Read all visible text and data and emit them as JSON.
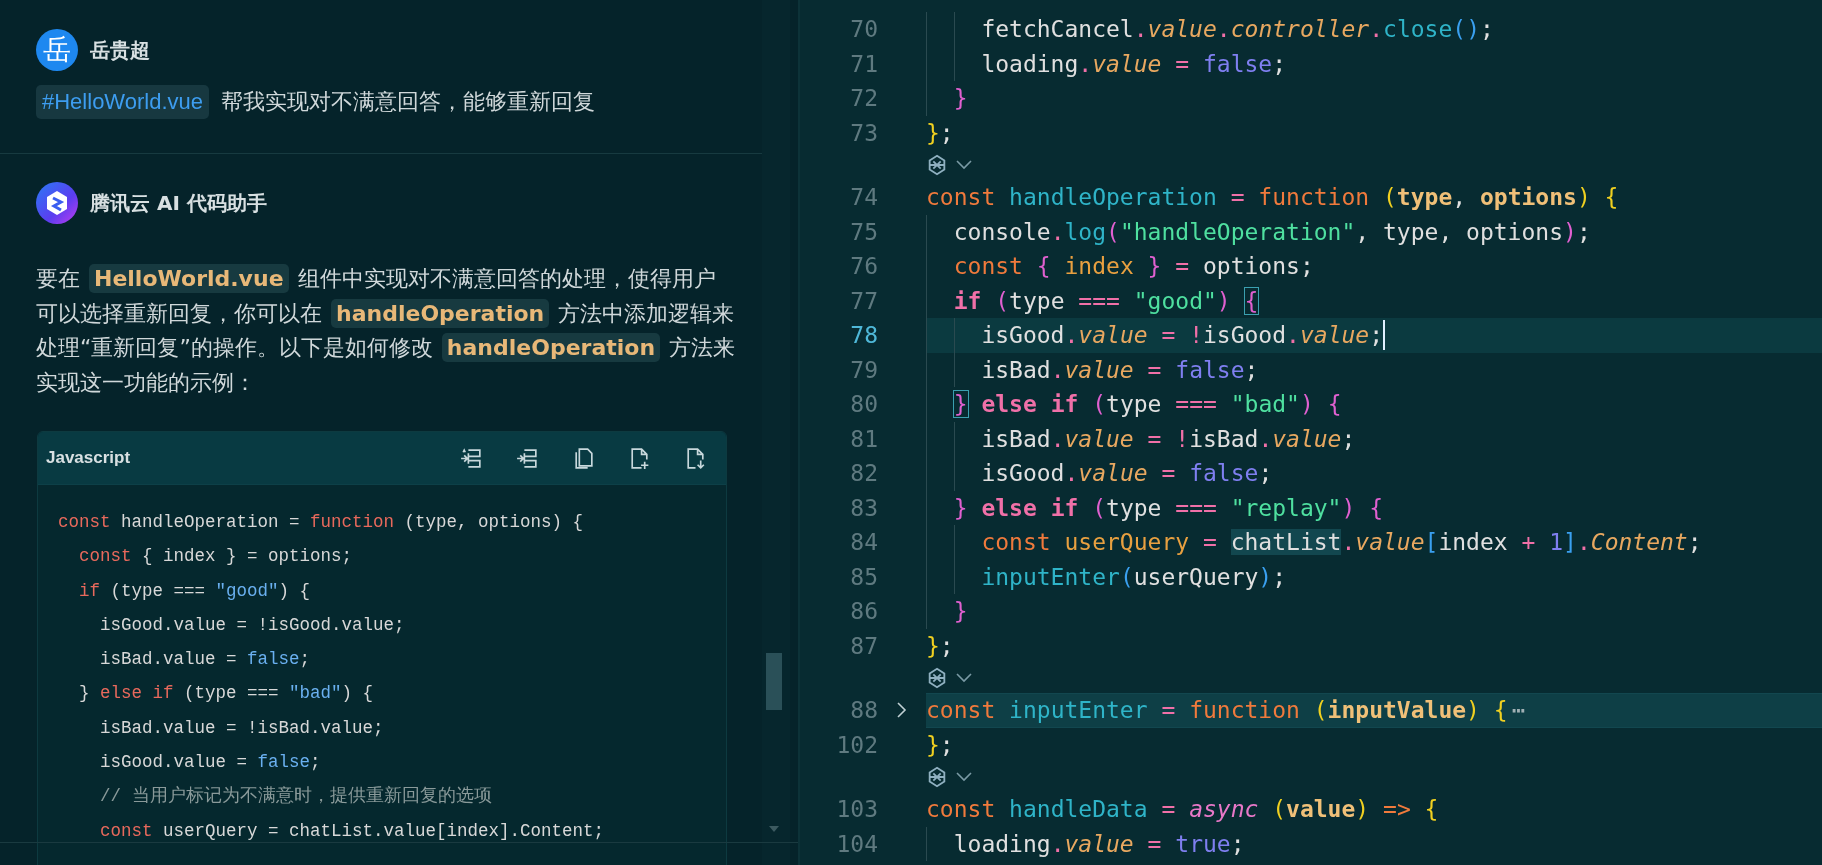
{
  "chat": {
    "messages": [
      {
        "kind": "user",
        "avatar": "岳",
        "author": "岳贵超",
        "tag": "#HelloWorld.vue",
        "text": "帮我实现对不满意回答，能够重新回复"
      },
      {
        "kind": "assistant",
        "author": "腾讯云 AI 代码助手",
        "segments": [
          {
            "kind": "text",
            "text": "要在 "
          },
          {
            "kind": "code",
            "text": "HelloWorld.vue"
          },
          {
            "kind": "text",
            "text": " 组件中实现对不满意回答的处理，使得用户可以选择重新回复，你可以在 "
          },
          {
            "kind": "code",
            "text": "handleOperation"
          },
          {
            "kind": "text",
            "text": " 方法中添加逻辑来处理“重新回复”的操作。以下是如何修改 "
          },
          {
            "kind": "code",
            "text": "handleOperation"
          },
          {
            "kind": "text",
            "text": " 方法来实现这一功能的示例："
          }
        ],
        "code_block": {
          "language": "Javascript",
          "lines": [
            [
              {
                "kind": "kw",
                "text": "const "
              },
              {
                "kind": "id",
                "text": "handleOperation = "
              },
              {
                "kind": "kw",
                "text": "function "
              },
              {
                "kind": "id",
                "text": "(type, options) {"
              }
            ],
            [
              {
                "kind": "kw",
                "text": "  const "
              },
              {
                "kind": "id",
                "text": "{ index } = options;"
              }
            ],
            [
              {
                "kind": "kw",
                "text": "  if "
              },
              {
                "kind": "id",
                "text": "(type === "
              },
              {
                "kind": "str",
                "text": "\"good\""
              },
              {
                "kind": "id",
                "text": ") {"
              }
            ],
            [
              {
                "kind": "id",
                "text": "    isGood.value = !isGood.value;"
              }
            ],
            [
              {
                "kind": "id",
                "text": "    isBad.value = "
              },
              {
                "kind": "bool",
                "text": "false"
              },
              {
                "kind": "id",
                "text": ";"
              }
            ],
            [
              {
                "kind": "id",
                "text": "  } "
              },
              {
                "kind": "kw",
                "text": "else if "
              },
              {
                "kind": "id",
                "text": "(type === "
              },
              {
                "kind": "str",
                "text": "\"bad\""
              },
              {
                "kind": "id",
                "text": ") {"
              }
            ],
            [
              {
                "kind": "id",
                "text": "    isBad.value = !isBad.value;"
              }
            ],
            [
              {
                "kind": "id",
                "text": "    isGood.value = "
              },
              {
                "kind": "bool",
                "text": "false"
              },
              {
                "kind": "id",
                "text": ";"
              }
            ],
            [
              {
                "kind": "cm",
                "text": "    // 当用户标记为不满意时，提供重新回复的选项"
              }
            ],
            [
              {
                "kind": "kw",
                "text": "    const "
              },
              {
                "kind": "id",
                "text": "userQuery = chatList.value[index].Content;"
              }
            ]
          ]
        }
      }
    ]
  },
  "editor": {
    "lines": [
      {
        "kind": "code",
        "number": "70",
        "current": false,
        "folded": false,
        "tokens": [
          {
            "kind": "id",
            "text": "    fetchCancel"
          },
          {
            "kind": "op",
            "text": "."
          },
          {
            "kind": "prop",
            "text": "value"
          },
          {
            "kind": "op",
            "text": "."
          },
          {
            "kind": "prop",
            "text": "controller"
          },
          {
            "kind": "op",
            "text": "."
          },
          {
            "kind": "fn",
            "text": "close"
          },
          {
            "kind": "bl",
            "text": "()"
          },
          {
            "kind": "id",
            "text": ";"
          }
        ]
      },
      {
        "kind": "code",
        "number": "71",
        "current": false,
        "folded": false,
        "tokens": [
          {
            "kind": "id",
            "text": "    loading"
          },
          {
            "kind": "op",
            "text": "."
          },
          {
            "kind": "prop",
            "text": "value"
          },
          {
            "kind": "op",
            "text": " = "
          },
          {
            "kind": "bool",
            "text": "false"
          },
          {
            "kind": "id",
            "text": ";"
          }
        ]
      },
      {
        "kind": "code",
        "number": "72",
        "current": false,
        "folded": false,
        "tokens": [
          {
            "kind": "pk",
            "text": "  }"
          }
        ]
      },
      {
        "kind": "code",
        "number": "73",
        "current": false,
        "folded": false,
        "tokens": [
          {
            "kind": "y",
            "text": "}"
          },
          {
            "kind": "id",
            "text": ";"
          }
        ]
      },
      {
        "kind": "lens"
      },
      {
        "kind": "code",
        "number": "74",
        "current": false,
        "folded": false,
        "tokens": [
          {
            "kind": "kw",
            "text": "const "
          },
          {
            "kind": "fn",
            "text": "handleOperation"
          },
          {
            "kind": "op",
            "text": " = "
          },
          {
            "kind": "kw",
            "text": "function "
          },
          {
            "kind": "y",
            "text": "("
          },
          {
            "kind": "par",
            "text": "type"
          },
          {
            "kind": "id",
            "text": ", "
          },
          {
            "kind": "par",
            "text": "options"
          },
          {
            "kind": "y",
            "text": ") {"
          }
        ]
      },
      {
        "kind": "code",
        "number": "75",
        "current": false,
        "folded": false,
        "tokens": [
          {
            "kind": "id",
            "text": "  console"
          },
          {
            "kind": "op",
            "text": "."
          },
          {
            "kind": "fn",
            "text": "log"
          },
          {
            "kind": "pk",
            "text": "("
          },
          {
            "kind": "str",
            "text": "\"handleOperation\""
          },
          {
            "kind": "id",
            "text": ", type, options"
          },
          {
            "kind": "pk",
            "text": ")"
          },
          {
            "kind": "id",
            "text": ";"
          }
        ]
      },
      {
        "kind": "code",
        "number": "76",
        "current": false,
        "folded": false,
        "tokens": [
          {
            "kind": "kw",
            "text": "  const "
          },
          {
            "kind": "pk",
            "text": "{"
          },
          {
            "kind": "var",
            "text": " index "
          },
          {
            "kind": "pk",
            "text": "}"
          },
          {
            "kind": "op",
            "text": " = "
          },
          {
            "kind": "id",
            "text": "options;"
          }
        ]
      },
      {
        "kind": "code",
        "number": "77",
        "current": false,
        "folded": false,
        "tokens": [
          {
            "kind": "ctl",
            "text": "  if "
          },
          {
            "kind": "pk",
            "text": "("
          },
          {
            "kind": "id",
            "text": "type "
          },
          {
            "kind": "op",
            "text": "=== "
          },
          {
            "kind": "str",
            "text": "\"good\""
          },
          {
            "kind": "pk",
            "text": ") "
          },
          {
            "kind": "pm",
            "text": "{"
          }
        ]
      },
      {
        "kind": "code",
        "number": "78",
        "current": true,
        "folded": false,
        "tokens": [
          {
            "kind": "id",
            "text": "    isGood"
          },
          {
            "kind": "op",
            "text": "."
          },
          {
            "kind": "prop",
            "text": "value"
          },
          {
            "kind": "op",
            "text": " = !"
          },
          {
            "kind": "id",
            "text": "isGood"
          },
          {
            "kind": "op",
            "text": "."
          },
          {
            "kind": "prop",
            "text": "value"
          },
          {
            "kind": "id",
            "text": ";"
          }
        ]
      },
      {
        "kind": "code",
        "number": "79",
        "current": false,
        "folded": false,
        "tokens": [
          {
            "kind": "id",
            "text": "    isBad"
          },
          {
            "kind": "op",
            "text": "."
          },
          {
            "kind": "prop",
            "text": "value"
          },
          {
            "kind": "op",
            "text": " = "
          },
          {
            "kind": "bool",
            "text": "false"
          },
          {
            "kind": "id",
            "text": ";"
          }
        ]
      },
      {
        "kind": "code",
        "number": "80",
        "current": false,
        "folded": false,
        "tokens": [
          {
            "kind": "pm",
            "text": "  }"
          },
          {
            "kind": "ctl",
            "text": " else if "
          },
          {
            "kind": "pk",
            "text": "("
          },
          {
            "kind": "id",
            "text": "type "
          },
          {
            "kind": "op",
            "text": "=== "
          },
          {
            "kind": "str",
            "text": "\"bad\""
          },
          {
            "kind": "pk",
            "text": ") {"
          }
        ]
      },
      {
        "kind": "code",
        "number": "81",
        "current": false,
        "folded": false,
        "tokens": [
          {
            "kind": "id",
            "text": "    isBad"
          },
          {
            "kind": "op",
            "text": "."
          },
          {
            "kind": "prop",
            "text": "value"
          },
          {
            "kind": "op",
            "text": " = !"
          },
          {
            "kind": "id",
            "text": "isBad"
          },
          {
            "kind": "op",
            "text": "."
          },
          {
            "kind": "prop",
            "text": "value"
          },
          {
            "kind": "id",
            "text": ";"
          }
        ]
      },
      {
        "kind": "code",
        "number": "82",
        "current": false,
        "folded": false,
        "tokens": [
          {
            "kind": "id",
            "text": "    isGood"
          },
          {
            "kind": "op",
            "text": "."
          },
          {
            "kind": "prop",
            "text": "value"
          },
          {
            "kind": "op",
            "text": " = "
          },
          {
            "kind": "bool",
            "text": "false"
          },
          {
            "kind": "id",
            "text": ";"
          }
        ]
      },
      {
        "kind": "code",
        "number": "83",
        "current": false,
        "folded": false,
        "tokens": [
          {
            "kind": "pk",
            "text": "  }"
          },
          {
            "kind": "ctl",
            "text": " else if "
          },
          {
            "kind": "pk",
            "text": "("
          },
          {
            "kind": "id",
            "text": "type "
          },
          {
            "kind": "op",
            "text": "=== "
          },
          {
            "kind": "str",
            "text": "\"replay\""
          },
          {
            "kind": "pk",
            "text": ") {"
          }
        ]
      },
      {
        "kind": "code",
        "number": "84",
        "current": false,
        "folded": false,
        "tokens": [
          {
            "kind": "kw",
            "text": "    const "
          },
          {
            "kind": "var",
            "text": "userQuery"
          },
          {
            "kind": "op",
            "text": " = "
          },
          {
            "kind": "wh",
            "text": "chatList"
          },
          {
            "kind": "op",
            "text": "."
          },
          {
            "kind": "prop",
            "text": "value"
          },
          {
            "kind": "bl",
            "text": "["
          },
          {
            "kind": "id",
            "text": "index "
          },
          {
            "kind": "op",
            "text": "+"
          },
          {
            "kind": "num",
            "text": " 1"
          },
          {
            "kind": "bl",
            "text": "]"
          },
          {
            "kind": "op",
            "text": "."
          },
          {
            "kind": "prop",
            "text": "Content"
          },
          {
            "kind": "id",
            "text": ";"
          }
        ]
      },
      {
        "kind": "code",
        "number": "85",
        "current": false,
        "folded": false,
        "tokens": [
          {
            "kind": "fn",
            "text": "    inputEnter"
          },
          {
            "kind": "bl",
            "text": "("
          },
          {
            "kind": "id",
            "text": "userQuery"
          },
          {
            "kind": "bl",
            "text": ")"
          },
          {
            "kind": "id",
            "text": ";"
          }
        ]
      },
      {
        "kind": "code",
        "number": "86",
        "current": false,
        "folded": false,
        "tokens": [
          {
            "kind": "pk",
            "text": "  }"
          }
        ]
      },
      {
        "kind": "code",
        "number": "87",
        "current": false,
        "folded": false,
        "tokens": [
          {
            "kind": "y",
            "text": "}"
          },
          {
            "kind": "id",
            "text": ";"
          }
        ]
      },
      {
        "kind": "lens"
      },
      {
        "kind": "code",
        "number": "88",
        "current": false,
        "folded": true,
        "tokens": [
          {
            "kind": "kw",
            "text": "const "
          },
          {
            "kind": "fn",
            "text": "inputEnter"
          },
          {
            "kind": "op",
            "text": " = "
          },
          {
            "kind": "kw",
            "text": "function "
          },
          {
            "kind": "y",
            "text": "("
          },
          {
            "kind": "par",
            "text": "inputValue"
          },
          {
            "kind": "y",
            "text": ") {"
          },
          {
            "kind": "fold",
            "text": "⋯"
          }
        ]
      },
      {
        "kind": "code",
        "number": "102",
        "current": false,
        "folded": false,
        "tokens": [
          {
            "kind": "y",
            "text": "}"
          },
          {
            "kind": "id",
            "text": ";"
          }
        ]
      },
      {
        "kind": "lens"
      },
      {
        "kind": "code",
        "number": "103",
        "current": false,
        "folded": false,
        "tokens": [
          {
            "kind": "kw",
            "text": "const "
          },
          {
            "kind": "fn",
            "text": "handleData"
          },
          {
            "kind": "op",
            "text": " = "
          },
          {
            "kind": "async",
            "text": "async "
          },
          {
            "kind": "y",
            "text": "("
          },
          {
            "kind": "par",
            "text": "value"
          },
          {
            "kind": "y",
            "text": ")"
          },
          {
            "kind": "kw",
            "text": " => "
          },
          {
            "kind": "y",
            "text": "{"
          }
        ]
      },
      {
        "kind": "code",
        "number": "104",
        "current": false,
        "folded": false,
        "tokens": [
          {
            "kind": "id",
            "text": "  loading"
          },
          {
            "kind": "op",
            "text": "."
          },
          {
            "kind": "prop",
            "text": "value"
          },
          {
            "kind": "op",
            "text": " = "
          },
          {
            "kind": "bool",
            "text": "true"
          },
          {
            "kind": "id",
            "text": ";"
          }
        ]
      }
    ]
  }
}
